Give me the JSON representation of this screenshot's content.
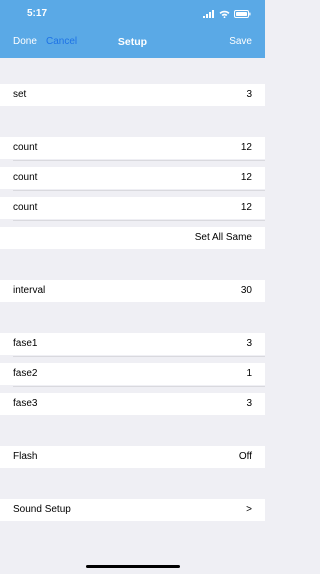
{
  "status": {
    "time": "5:17"
  },
  "nav": {
    "done": "Done",
    "cancel": "Cancel",
    "title": "Setup",
    "save": "Save"
  },
  "rows": {
    "set": {
      "label": "set",
      "value": "3"
    },
    "count1": {
      "label": "count",
      "value": "12"
    },
    "count2": {
      "label": "count",
      "value": "12"
    },
    "count3": {
      "label": "count",
      "value": "12"
    },
    "set_all_same": {
      "label": "Set All Same"
    },
    "interval": {
      "label": "interval",
      "value": "30"
    },
    "fase1": {
      "label": "fase1",
      "value": "3"
    },
    "fase2": {
      "label": "fase2",
      "value": "1"
    },
    "fase3": {
      "label": "fase3",
      "value": "3"
    },
    "flash": {
      "label": "Flash",
      "value": "Off"
    },
    "sound_setup": {
      "label": "Sound Setup",
      "value": ">"
    }
  }
}
